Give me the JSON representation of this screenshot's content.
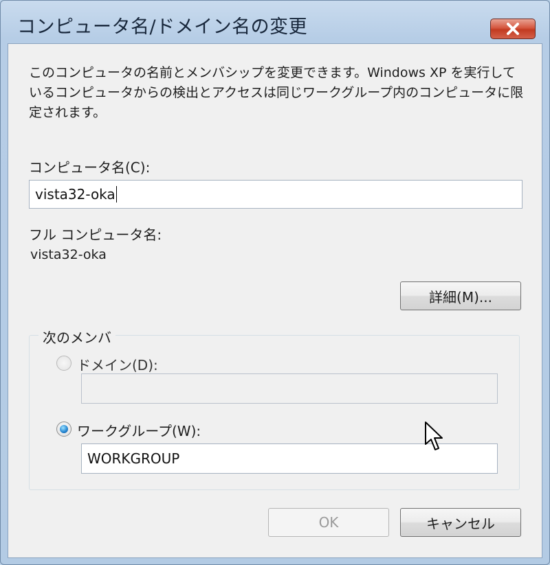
{
  "window": {
    "title": "コンピュータ名/ドメイン名の変更",
    "close_glyph": "✕"
  },
  "description": "このコンピュータの名前とメンバシップを変更できます。Windows XP を実行しているコンピュータからの検出とアクセスは同じワークグループ内のコンピュータに限定されます。",
  "computer_name": {
    "label": "コンピュータ名(C):",
    "value": "vista32-oka"
  },
  "full_name": {
    "label": "フル コンピュータ名:",
    "value": "vista32-oka"
  },
  "details_button": "詳細(M)...",
  "membership": {
    "title": "次のメンバ",
    "domain": {
      "label": "ドメイン(D):",
      "value": "",
      "selected": false,
      "enabled": false
    },
    "workgroup": {
      "label": "ワークグループ(W):",
      "value": "WORKGROUP",
      "selected": true
    }
  },
  "buttons": {
    "ok": "OK",
    "cancel": "キャンセル"
  },
  "colors": {
    "frame": "#b6cde6",
    "close_red": "#c23b21",
    "client_bg": "#f0f0f0",
    "radio_selected": "#2a8ad4"
  },
  "icons": {
    "close": "close-icon",
    "cursor": "mouse-pointer-icon"
  }
}
